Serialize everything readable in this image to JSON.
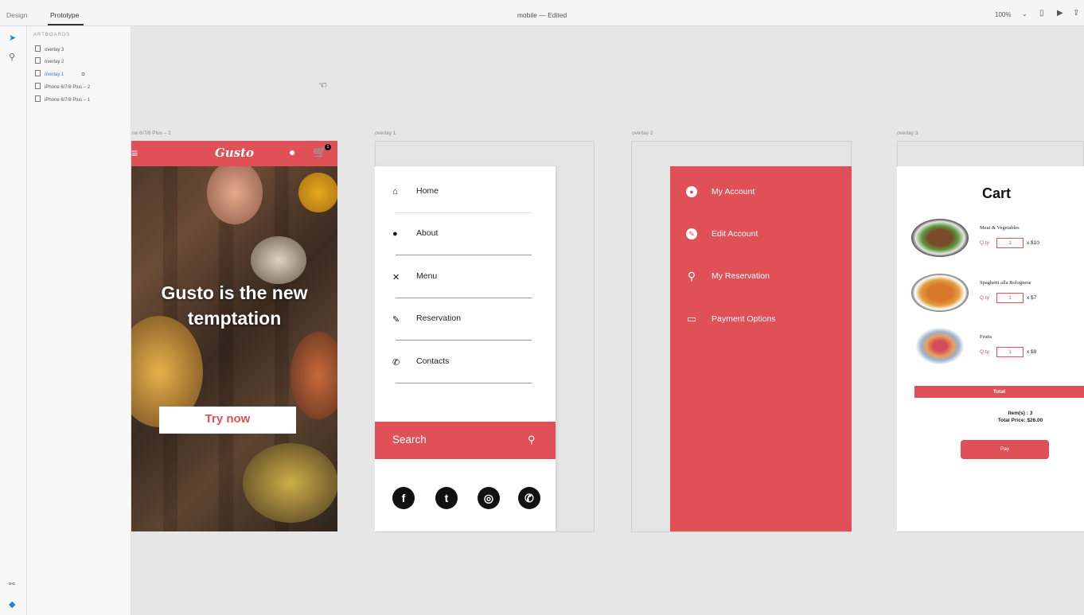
{
  "tabs": [
    "Design",
    "Prototype"
  ],
  "document_title": "mobile — Edited",
  "zoom": "100%",
  "layers_panel": {
    "title": "ARTBOARDS",
    "items": [
      "overlay 3",
      "overlay 2",
      "overlay 1",
      "iPhone 6/7/8 Plus – 2",
      "iPhone 6/7/8 Plus – 1"
    ]
  },
  "artboard_labels": {
    "main": "ne 6/7/8 Plus – 2",
    "overlay1": "overlay 1",
    "overlay2": "overlay 2",
    "overlay3": "overlay 3"
  },
  "home_screen": {
    "logo": "Gusto",
    "headline_line1": "Gusto is the new",
    "headline_line2": "temptation",
    "cta": "Try now",
    "cart_badge": "1"
  },
  "overlay1": {
    "menu": [
      "Home",
      "About",
      "Menu",
      "Reservation",
      "Contacts"
    ],
    "search_label": "Search"
  },
  "overlay2": {
    "items": [
      "My Account",
      "Edit Account",
      "My Reservation",
      "Payment Options"
    ]
  },
  "overlay3": {
    "title": "Cart",
    "qty_label": "Q.ty",
    "items": [
      {
        "name": "Meat & Vegetables",
        "qty": "1",
        "price": "x $10"
      },
      {
        "name": "Spaghetti alla Bolognese",
        "qty": "1",
        "price": "x $7"
      },
      {
        "name": "Fruits",
        "qty": "1",
        "price": "x $9"
      }
    ],
    "total_label": "Total",
    "items_count": "Item(s) : 3",
    "total_price": "Total Price: $26.00",
    "pay": "Pay"
  },
  "colors": {
    "accent": "#df5057"
  }
}
